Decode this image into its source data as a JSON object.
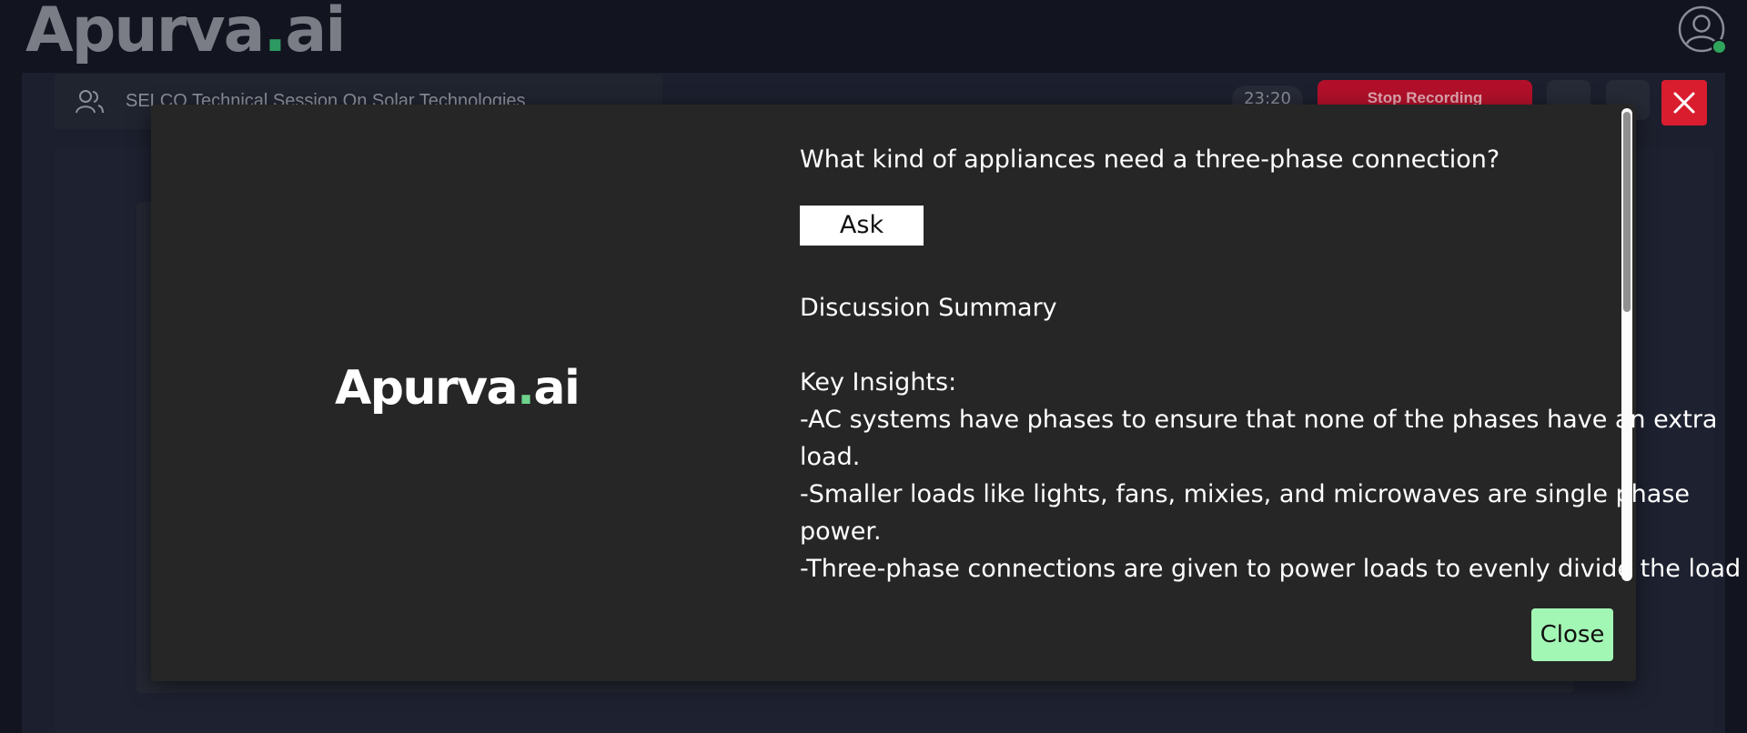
{
  "app": {
    "logo_text": "Apurva",
    "logo_dot": ".",
    "logo_suffix": "ai"
  },
  "header": {
    "user_icon": "user-circle-icon",
    "online_color": "#2fa55c"
  },
  "session": {
    "title": "SELCO Technical Session On Solar Technologies",
    "timer": "23:20",
    "stop_label": "Stop Recording"
  },
  "modal": {
    "logo_text": "Apurva",
    "logo_dot": ".",
    "logo_suffix": "ai",
    "question": "What kind of appliances need a three-phase connection?",
    "ask_label": "Ask",
    "summary_title": "Discussion Summary",
    "insights_title": "Key Insights:",
    "insights": [
      "-AC systems have phases to ensure that none of the phases have an extra load.",
      "-Smaller loads like lights, fans, mixies, and microwaves are single phase power.",
      "-Three-phase connections are given to power loads to evenly divide the load"
    ],
    "close_label": "Close"
  },
  "colors": {
    "accent_green": "#a3f7b5",
    "stop_red": "#b2102a",
    "close_red": "#d91d2f",
    "logo_dot": "#6ed38d"
  }
}
